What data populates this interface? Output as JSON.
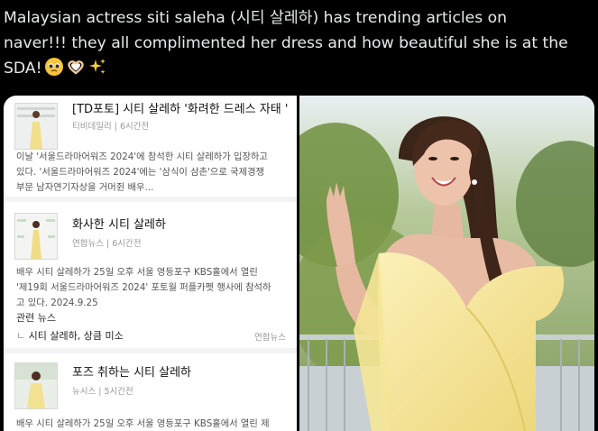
{
  "tweet": {
    "text": "Malaysian actress siti saleha (시티 살레하) has trending articles on\nnaver!!! they all complimented her dress and how beautiful she is at the\nSDA!",
    "emojis": [
      "pleading-face-icon",
      "heart-hands-icon",
      "sparkles-icon"
    ]
  },
  "articles": [
    {
      "headline": "[TD포토] 시티 살레하 '화려한 드레스 자태 '",
      "source": "티비데일리",
      "time": "6시간전",
      "summary": "이날 '서울드라마어워즈 2024'에 참석한 시티 살레하가 입장하고\n있다. '서울드라마어워즈 2024'에는 '삼식이 삼촌'으로 국제경쟁\n부문 남자연기자상을 거머쥔 배우..."
    },
    {
      "headline": "화사한 시티 살레하",
      "source": "연합뉴스",
      "time": "6시간전",
      "summary": "배우 시티 살레하가 25일 오후 서울 영등포구 KBS홀에서 열린\n'제19회 서울드라마어워즈 2024' 포토월 퍼플카펫 행사에 참석하\n고 있다. 2024.9.25"
    },
    {
      "headline": "포즈 취하는 시티 살레하",
      "source": "뉴시스",
      "time": "5시간전",
      "summary": "배우 시티 살레하가 25일 오후 서울 영등포구 KBS홀에서 열린 제"
    }
  ],
  "related": {
    "title": "관련 뉴스",
    "item": "시티 살레하, 상큼 미소",
    "item_prefix": "ㄴ",
    "source": "연합뉴스"
  },
  "colors": {
    "background": "#000000",
    "text": "#e7e9ea",
    "dress": "#f6e7a0"
  }
}
